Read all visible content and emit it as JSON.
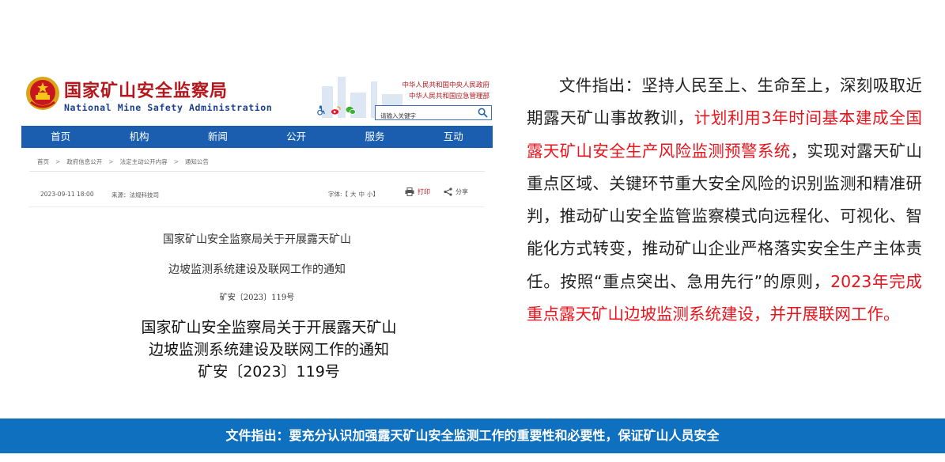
{
  "site": {
    "logo_cn": "国家矿山安全监察局",
    "logo_en": "National Mine Safety Administration",
    "gov_line1": "中华人民共和国中央人民政府",
    "gov_line2": "中华人民共和国应急管理部",
    "search_placeholder": "请输入关键字",
    "nav": [
      "首页",
      "机构",
      "新闻",
      "公开",
      "服务",
      "互动"
    ],
    "breadcrumb": [
      "首页",
      "政府信息公开",
      "法定主动公开内容",
      "通知公告"
    ],
    "date": "2023-09-11 18:00",
    "source": "来源：法规科技司",
    "fontsize_label": "字体:【",
    "fontsize_big": "大",
    "fontsize_mid": "中",
    "fontsize_small": "小】",
    "print_label": "打印",
    "share_label": "分享",
    "doc_title_1": "国家矿山安全监察局关于开展露天矿山",
    "doc_title_2": "边坡监测系统建设及联网工作的通知",
    "doc_number": "矿安〔2023〕119号"
  },
  "caption": {
    "line1": "国家矿山安全监察局关于开展露天矿山",
    "line2": "边坡监测系统建设及联网工作的通知",
    "line3": "矿安〔2023〕119号"
  },
  "paragraph": {
    "p1": "文件指出：坚持人民至上、生命至上，深刻吸取近期露天矿山事故教训，",
    "h1": "计划利用3年时间基本建成全国露天矿山安全生产风险监测预警系统",
    "p2": "，实现对露天矿山重点区域、关键环节重大安全风险的识别监测和精准研判，推动矿山安全监管监察模式向远程化、可视化、智能化方式转变，推动矿山企业严格落实安全生产主体责任。按照“重点突出、急用先行”的原则，",
    "h2": "2023年完成重点露天矿山边坡监测系统建设，并开展联网工作。"
  },
  "banner": {
    "text": "文件指出：要充分认识加强露天矿山安全监测工作的重要性和必要性，保证矿山人员安全"
  },
  "colors": {
    "nav_blue": "#1b5eaf",
    "banner_blue": "#0f70bf",
    "logo_red": "#b4161b",
    "highlight_red": "#e8131b"
  },
  "icons": [
    "national-emblem-icon",
    "accessibility-icon",
    "weibo-icon",
    "wechat-icon",
    "search-icon",
    "print-icon",
    "share-icon"
  ]
}
